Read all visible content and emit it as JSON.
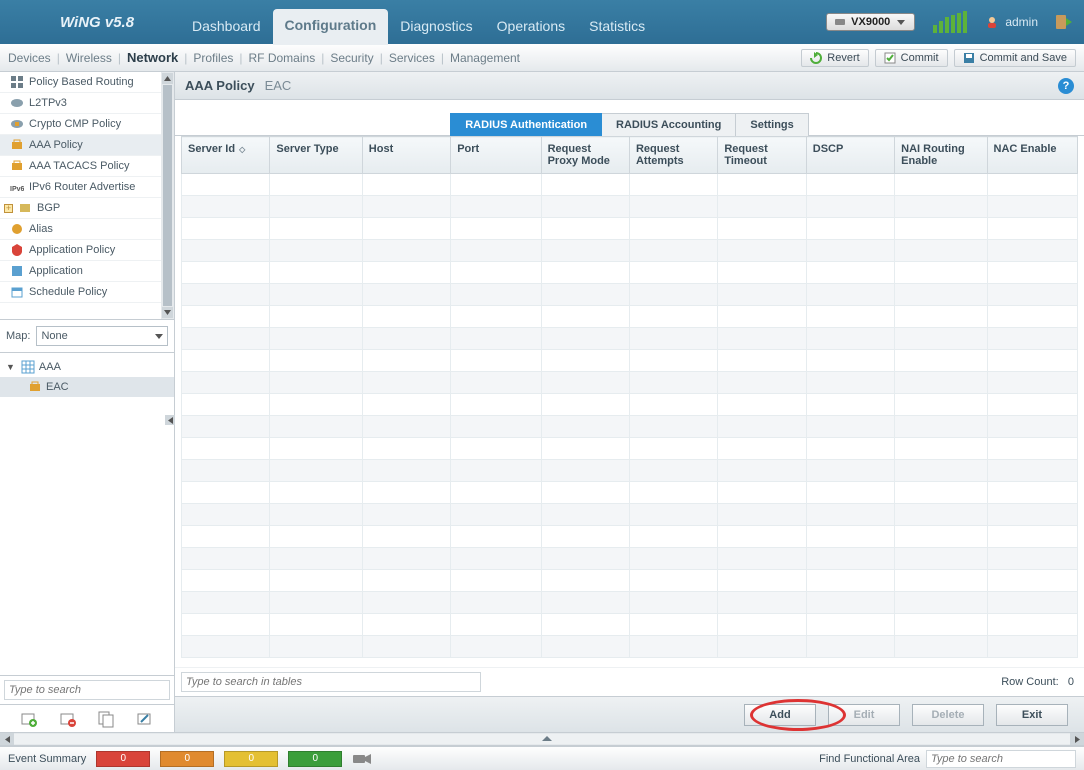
{
  "brand": "WiNG v5.8",
  "topnav": [
    "Dashboard",
    "Configuration",
    "Diagnostics",
    "Operations",
    "Statistics"
  ],
  "topnav_active": 1,
  "device_name": "VX9000",
  "user": "admin",
  "subnav": [
    "Devices",
    "Wireless",
    "Network",
    "Profiles",
    "RF Domains",
    "Security",
    "Services",
    "Management"
  ],
  "subnav_active": 2,
  "subbuttons": {
    "revert": "Revert",
    "commit": "Commit",
    "commit_save": "Commit and Save"
  },
  "left_tree": [
    {
      "label": "Policy Based Routing",
      "icon": "routing"
    },
    {
      "label": "L2TPv3",
      "icon": "l2tp"
    },
    {
      "label": "Crypto CMP Policy",
      "icon": "crypto"
    },
    {
      "label": "AAA Policy",
      "icon": "aaa",
      "selected": true
    },
    {
      "label": "AAA TACACS Policy",
      "icon": "aaa"
    },
    {
      "label": "IPv6 Router Advertise",
      "icon": "ipv6"
    },
    {
      "label": "BGP",
      "icon": "bgp",
      "expandable": true
    },
    {
      "label": "Alias",
      "icon": "alias"
    },
    {
      "label": "Application Policy",
      "icon": "app-policy"
    },
    {
      "label": "Application",
      "icon": "app"
    },
    {
      "label": "Schedule Policy",
      "icon": "schedule"
    }
  ],
  "map_label": "Map:",
  "map_value": "None",
  "tree2": [
    {
      "label": "AAA",
      "icon": "grid",
      "expanded": true
    },
    {
      "label": "EAC",
      "icon": "aaa",
      "child": true,
      "selected": true
    }
  ],
  "left_search_placeholder": "Type to search",
  "title": {
    "main": "AAA Policy",
    "sub": "EAC"
  },
  "tabs": [
    "RADIUS Authentication",
    "RADIUS Accounting",
    "Settings"
  ],
  "tabs_active": 0,
  "columns": [
    "Server Id",
    "Server Type",
    "Host",
    "Port",
    "Request Proxy Mode",
    "Request Attempts",
    "Request Timeout",
    "DSCP",
    "NAI Routing Enable",
    "NAC Enable"
  ],
  "table_search_placeholder": "Type to search in tables",
  "row_count_label": "Row Count:",
  "row_count_value": "0",
  "actions": {
    "add": "Add",
    "edit": "Edit",
    "delete": "Delete",
    "exit": "Exit"
  },
  "bottombar": {
    "label": "Event Summary",
    "counts": [
      "0",
      "0",
      "0",
      "0"
    ],
    "ffa_label": "Find Functional Area",
    "ffa_placeholder": "Type to search"
  }
}
